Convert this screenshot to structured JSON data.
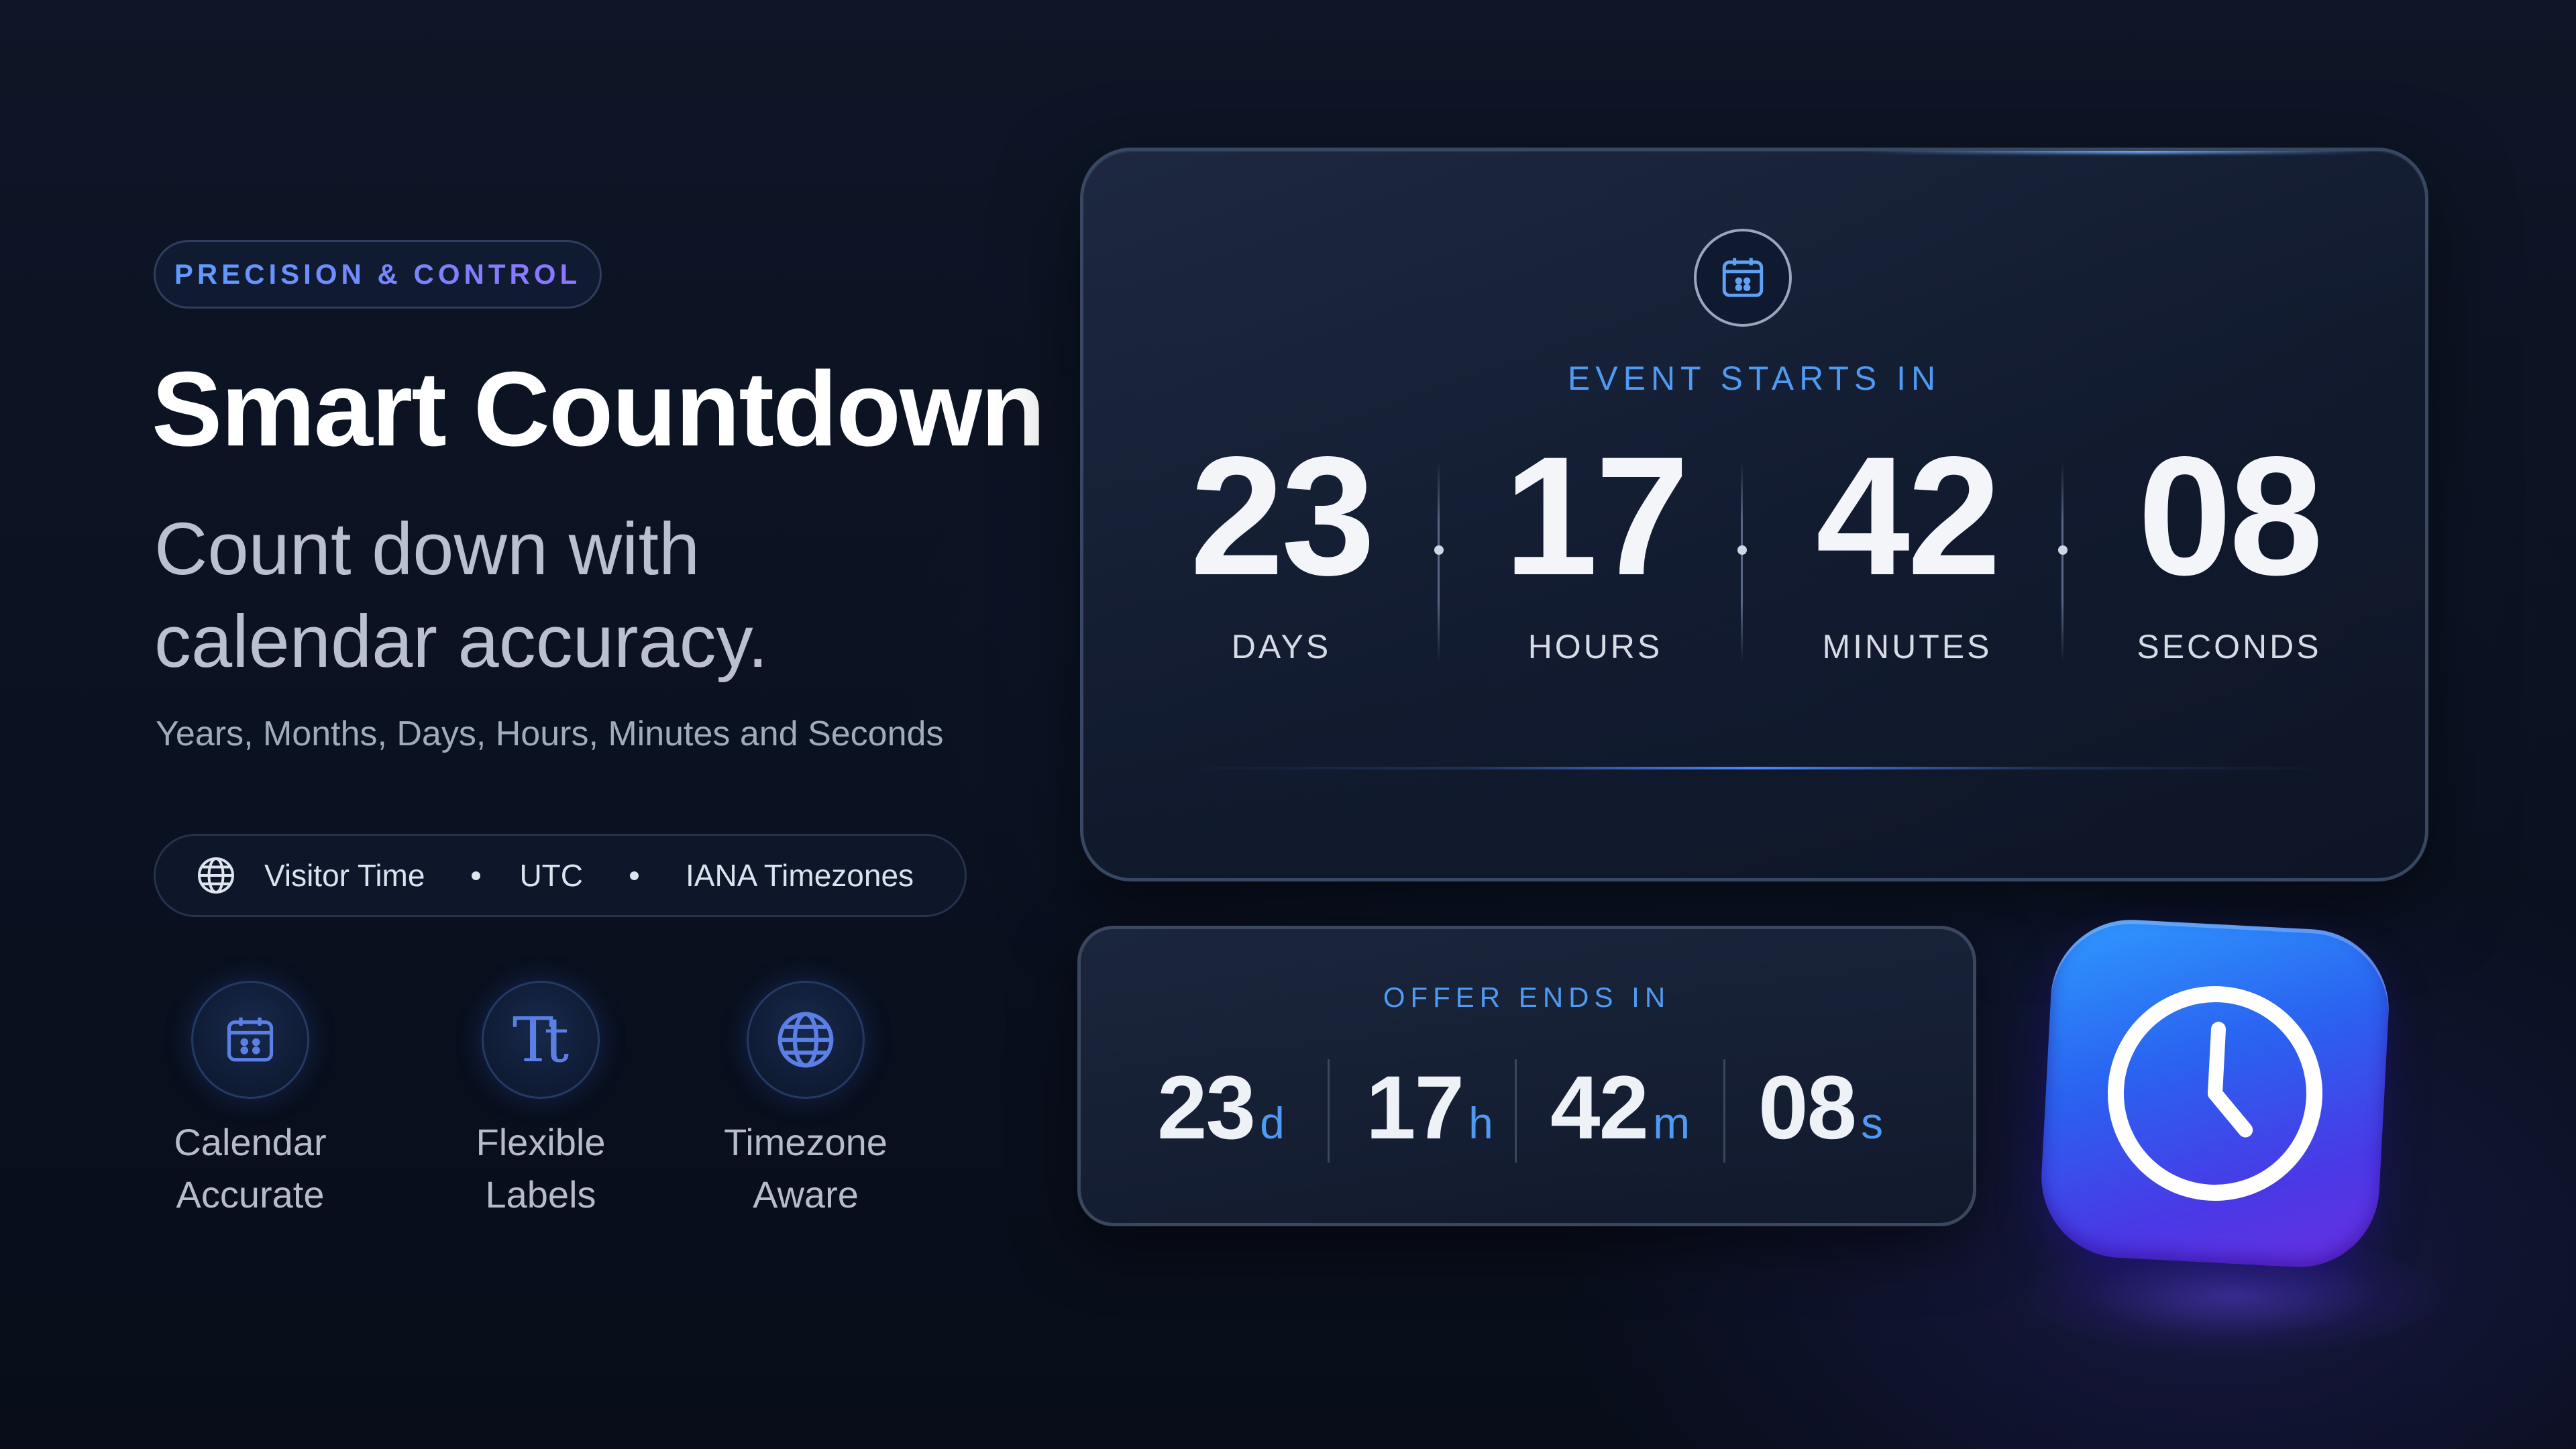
{
  "hero": {
    "eyebrow": "PRECISION & CONTROL",
    "title": "Smart Countdown",
    "subtitle_line1": "Count down with",
    "subtitle_line2": "calendar accuracy.",
    "units_line": "Years, Months, Days, Hours, Minutes and Seconds"
  },
  "timezone_options": {
    "icon": "globe-icon",
    "items": [
      "Visitor Time",
      "UTC",
      "IANA Timezones"
    ]
  },
  "features": [
    {
      "icon": "calendar-icon",
      "line1": "Calendar",
      "line2": "Accurate"
    },
    {
      "icon": "text-format-icon",
      "line1": "Flexible",
      "line2": "Labels"
    },
    {
      "icon": "globe-icon",
      "line1": "Timezone",
      "line2": "Aware"
    }
  ],
  "event_countdown": {
    "icon": "calendar-icon",
    "label": "EVENT STARTS IN",
    "units": [
      {
        "value": "23",
        "label": "DAYS"
      },
      {
        "value": "17",
        "label": "HOURS"
      },
      {
        "value": "42",
        "label": "MINUTES"
      },
      {
        "value": "08",
        "label": "SECONDS"
      }
    ]
  },
  "offer_countdown": {
    "label": "OFFER ENDS IN",
    "units": [
      {
        "value": "23",
        "suffix": "d"
      },
      {
        "value": "17",
        "suffix": "h"
      },
      {
        "value": "42",
        "suffix": "m"
      },
      {
        "value": "08",
        "suffix": "s"
      }
    ]
  },
  "app_icon": {
    "icon": "clock-icon"
  },
  "colors": {
    "accent_blue": "#4f9af2",
    "accent_purple": "#8e74ff",
    "background": "#0b1222"
  }
}
